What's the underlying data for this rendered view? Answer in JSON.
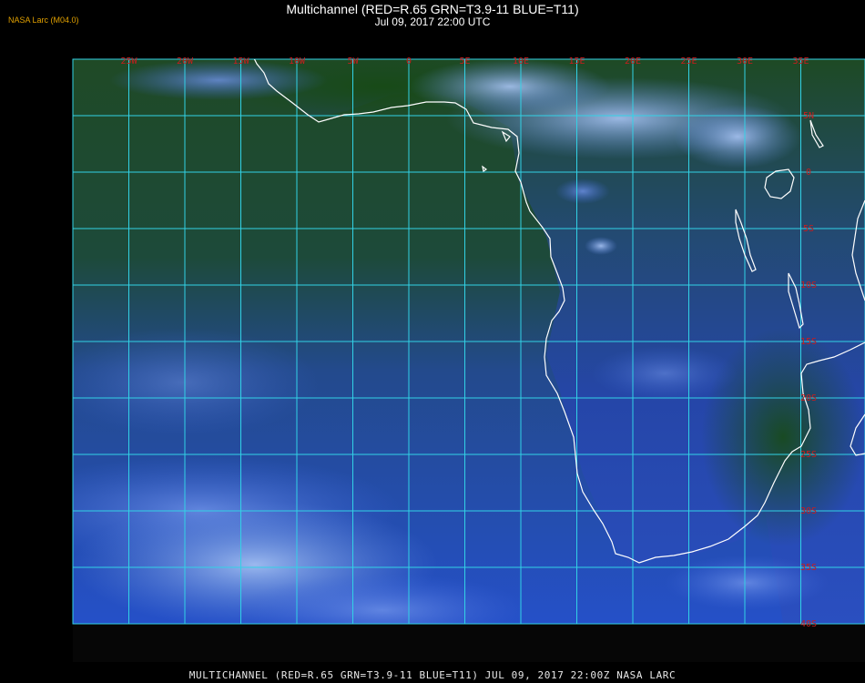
{
  "header": {
    "credit": "NASA Larc (M04.0)",
    "title": "Multichannel (RED=R.65 GRN=T3.9-11 BLUE=T11)",
    "subtitle": "Jul 09, 2017 22:00 UTC"
  },
  "footer": {
    "caption": "MULTICHANNEL (RED=R.65 GRN=T3.9-11 BLUE=T11) JUL 09, 2017 22:00Z    NASA LARC"
  },
  "map": {
    "lon_labels": [
      "25W",
      "20W",
      "15W",
      "10W",
      "5W",
      "0",
      "5E",
      "10E",
      "15E",
      "20E",
      "25E",
      "30E",
      "35E"
    ],
    "lat_labels": [
      "5N",
      "0",
      "5S",
      "10S",
      "15S",
      "20S",
      "25S",
      "30S",
      "35S",
      "40S"
    ],
    "colors": {
      "grid": "#32d2e6",
      "tick_label": "#cc1c1c",
      "coastline": "#ffffff",
      "ocean_blue": "#2a50c8",
      "land_green": "#1e4a1c",
      "cloud": "#8fb2ee"
    }
  }
}
